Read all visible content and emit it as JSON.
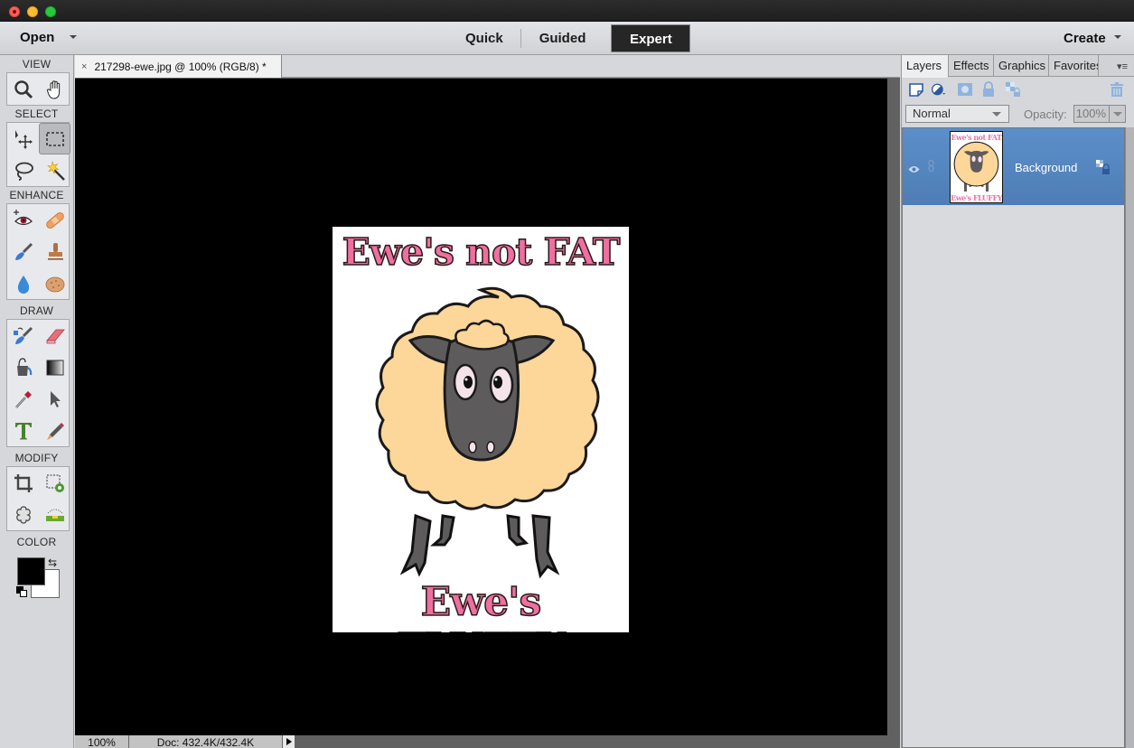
{
  "window": {
    "title_buttons": [
      "close",
      "minimize",
      "zoom"
    ]
  },
  "appbar": {
    "open_label": "Open",
    "modes": [
      {
        "label": "Quick",
        "active": false
      },
      {
        "label": "Guided",
        "active": false
      },
      {
        "label": "Expert",
        "active": true
      }
    ],
    "create_label": "Create"
  },
  "toolbox": {
    "sections": [
      {
        "title": "VIEW",
        "tools": [
          "zoom-tool",
          "hand-tool"
        ]
      },
      {
        "title": "SELECT",
        "tools": [
          "move-tool",
          "rectangular-marquee-tool",
          "lasso-tool",
          "magic-wand-tool"
        ],
        "selected": "rectangular-marquee-tool"
      },
      {
        "title": "ENHANCE",
        "tools": [
          "red-eye-tool",
          "healing-brush-tool",
          "smart-brush-tool",
          "clone-stamp-tool",
          "blur-tool",
          "sponge-tool"
        ]
      },
      {
        "title": "DRAW",
        "tools": [
          "brush-tool",
          "eraser-tool",
          "paint-bucket-tool",
          "gradient-tool",
          "eyedropper-tool",
          "custom-shape-tool",
          "type-tool",
          "pencil-tool"
        ]
      },
      {
        "title": "MODIFY",
        "tools": [
          "crop-tool",
          "recompose-tool",
          "content-aware-move-tool",
          "straighten-tool"
        ]
      },
      {
        "title": "COLOR"
      }
    ],
    "foreground_color": "#000000",
    "background_color": "#ffffff"
  },
  "document": {
    "tab_title": "217298-ewe.jpg @ 100% (RGB/8) *",
    "close_glyph": "×",
    "artwork": {
      "top_text": "Ewe's not FAT",
      "bottom_text": "Ewe's FLUFFY"
    },
    "status": {
      "zoom": "100%",
      "doc_info": "Doc: 432.4K/432.4K"
    }
  },
  "panel": {
    "tabs": [
      {
        "label": "Layers",
        "active": true
      },
      {
        "label": "Effects",
        "active": false
      },
      {
        "label": "Graphics",
        "active": false
      },
      {
        "label": "Favorites",
        "active": false
      }
    ],
    "blend_mode": "Normal",
    "opacity_label": "Opacity:",
    "opacity_value": "100%",
    "layers": [
      {
        "name": "Background",
        "visible": true,
        "locked": true,
        "selected": true,
        "thumb_top": "Ewe's not FAT",
        "thumb_bottom": "Ewe's FLUFFY"
      }
    ]
  },
  "colors": {
    "selection_blue": "#5b8fc9",
    "pink_text": "#ef6fa0",
    "wool": "#fdd699",
    "face": "#5e5b5c"
  }
}
